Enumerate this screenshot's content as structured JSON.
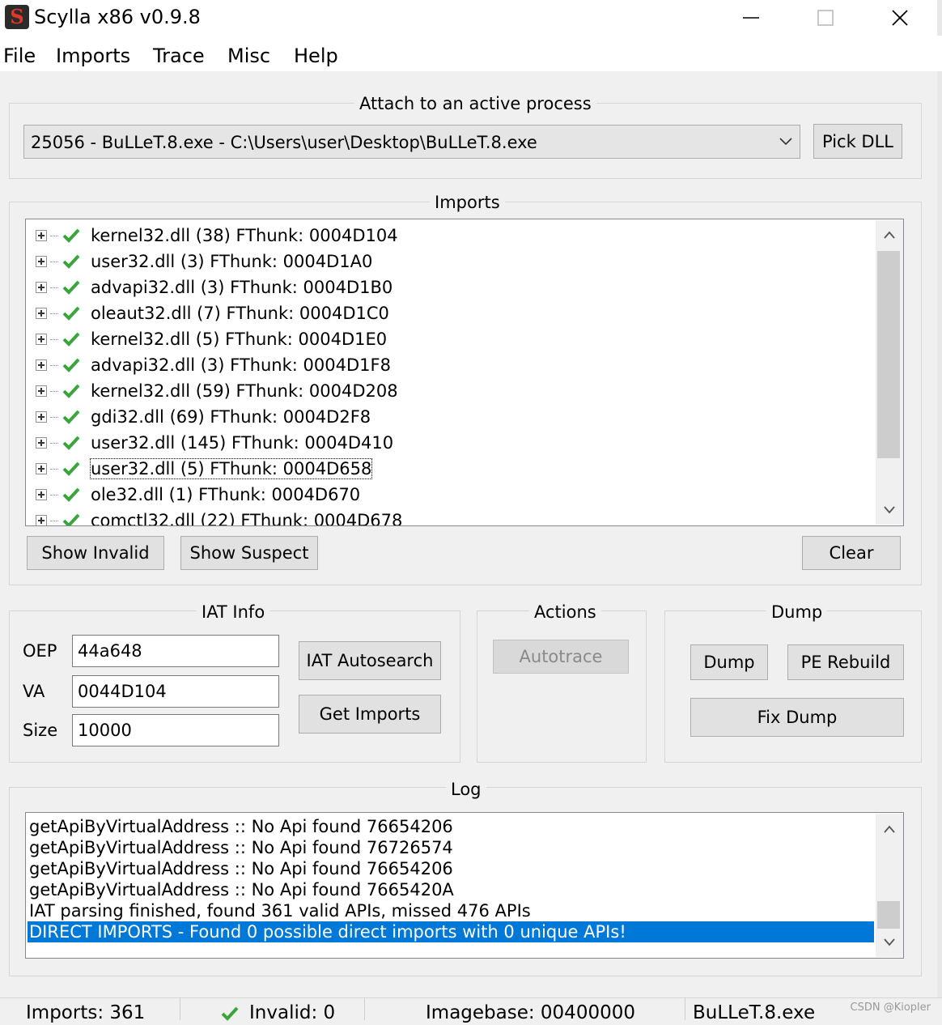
{
  "window": {
    "title": "Scylla x86 v0.9.8",
    "icon_letter": "S",
    "minimize": "—",
    "maximize": "☐",
    "close": "✕"
  },
  "menu": [
    "File",
    "Imports",
    "Trace",
    "Misc",
    "Help"
  ],
  "attach": {
    "label": "Attach to an active process",
    "process": "25056 - BuLLeT.8.exe - C:\\Users\\user\\Desktop\\BuLLeT.8.exe",
    "pick_dll": "Pick DLL"
  },
  "imports": {
    "label": "Imports",
    "items": [
      "kernel32.dll (38) FThunk: 0004D104",
      "user32.dll (3) FThunk: 0004D1A0",
      "advapi32.dll (3) FThunk: 0004D1B0",
      "oleaut32.dll (7) FThunk: 0004D1C0",
      "kernel32.dll (5) FThunk: 0004D1E0",
      "advapi32.dll (3) FThunk: 0004D1F8",
      "kernel32.dll (59) FThunk: 0004D208",
      "gdi32.dll (69) FThunk: 0004D2F8",
      "user32.dll (145) FThunk: 0004D410",
      "user32.dll (5) FThunk: 0004D658",
      "ole32.dll (1) FThunk: 0004D670",
      "comctl32.dll (22) FThunk: 0004D678"
    ],
    "focused_index": 9,
    "show_invalid": "Show Invalid",
    "show_suspect": "Show Suspect",
    "clear": "Clear"
  },
  "iat_info": {
    "label": "IAT Info",
    "oep_label": "OEP",
    "oep_value": "44a648",
    "va_label": "VA",
    "va_value": "0044D104",
    "size_label": "Size",
    "size_value": "10000",
    "autosearch": "IAT Autosearch",
    "get_imports": "Get Imports"
  },
  "actions": {
    "label": "Actions",
    "autotrace": "Autotrace"
  },
  "dump": {
    "label": "Dump",
    "dump": "Dump",
    "pe_rebuild": "PE Rebuild",
    "fix_dump": "Fix Dump"
  },
  "log": {
    "label": "Log",
    "lines": [
      "getApiByVirtualAddress :: No Api found 76654206",
      "getApiByVirtualAddress :: No Api found 76726574",
      "getApiByVirtualAddress :: No Api found 76654206",
      "getApiByVirtualAddress :: No Api found 7665420A",
      "IAT parsing finished, found 361 valid APIs, missed 476 APIs",
      "DIRECT IMPORTS - Found 0 possible direct imports with 0 unique APIs!"
    ],
    "selected_index": 5
  },
  "status": {
    "imports": "Imports: 361",
    "invalid": "Invalid: 0",
    "imagebase": "Imagebase: 00400000",
    "module": "BuLLeT.8.exe"
  },
  "watermark": "CSDN @Kiopler",
  "colors": {
    "selection": "#0078d7",
    "check": "#3aa53a",
    "window_bg": "#f0f0f0"
  }
}
